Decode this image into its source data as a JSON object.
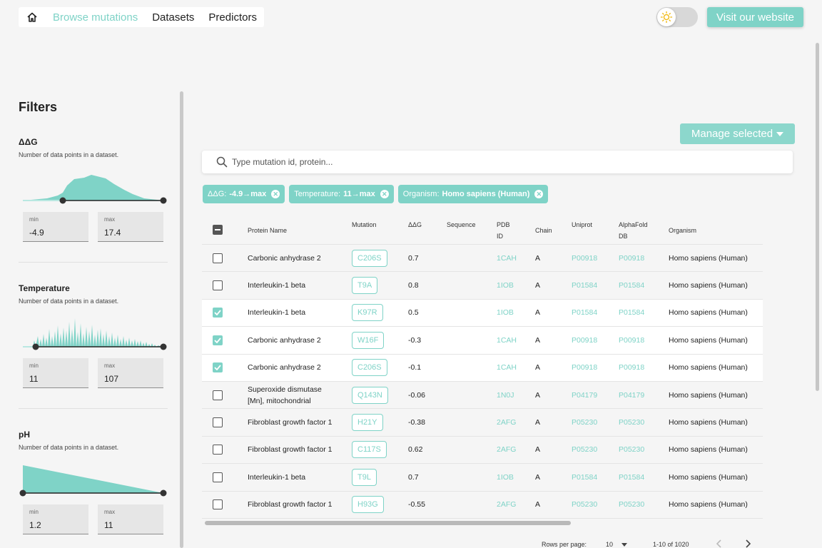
{
  "nav": {
    "items": [
      {
        "label": "Browse mutations",
        "active": true
      },
      {
        "label": "Datasets",
        "active": false
      },
      {
        "label": "Predictors",
        "active": false
      }
    ],
    "visit_label": "Visit our website"
  },
  "colors": {
    "accent": "#7fd3c7"
  },
  "icons": {
    "home": "home-icon",
    "theme": "sun-icon",
    "search": "search-icon"
  },
  "filters": {
    "title": "Filters",
    "items": [
      {
        "name": "ΔΔG",
        "description": "Number of data points in a dataset.",
        "min_label": "min",
        "max_label": "max",
        "min": "-4.9",
        "max": "17.4"
      },
      {
        "name": "Temperature",
        "description": "Number of data points in a dataset.",
        "min_label": "min",
        "max_label": "max",
        "min": "11",
        "max": "107"
      },
      {
        "name": "pH",
        "description": "Number of data points in a dataset.",
        "min_label": "min",
        "max_label": "max",
        "min": "1.2",
        "max": "11"
      }
    ]
  },
  "manage": {
    "label": "Manage selected"
  },
  "search": {
    "placeholder": "Type mutation id, protein..."
  },
  "chips": [
    {
      "label": "ΔΔG:",
      "value": "-4.9→max"
    },
    {
      "label": "Temperature:",
      "value": "11→max"
    },
    {
      "label": "Organism:",
      "value": "Homo sapiens (Human)"
    }
  ],
  "table": {
    "headers": {
      "protein": "Protein Name",
      "mutation": "Mutation",
      "ddg": "ΔΔG",
      "sequence": "Sequence",
      "pdb1": "PDB",
      "pdb2": "ID",
      "chain": "Chain",
      "uniprot": "Uniprot",
      "af1": "AlphaFold",
      "af2": "DB",
      "organism": "Organism"
    },
    "rows": [
      {
        "checked": false,
        "protein": "Carbonic anhydrase 2",
        "mutation": "C206S",
        "ddg": "0.7",
        "pdb": "1CAH",
        "chain": "A",
        "uniprot": "P00918",
        "alphafold": "P00918",
        "organism": "Homo sapiens (Human)"
      },
      {
        "checked": false,
        "protein": "Interleukin-1 beta",
        "mutation": "T9A",
        "ddg": "0.8",
        "pdb": "1IOB",
        "chain": "A",
        "uniprot": "P01584",
        "alphafold": "P01584",
        "organism": "Homo sapiens (Human)"
      },
      {
        "checked": true,
        "protein": "Interleukin-1 beta",
        "mutation": "K97R",
        "ddg": "0.5",
        "pdb": "1IOB",
        "chain": "A",
        "uniprot": "P01584",
        "alphafold": "P01584",
        "organism": "Homo sapiens (Human)"
      },
      {
        "checked": true,
        "protein": "Carbonic anhydrase 2",
        "mutation": "W16F",
        "ddg": "-0.3",
        "pdb": "1CAH",
        "chain": "A",
        "uniprot": "P00918",
        "alphafold": "P00918",
        "organism": "Homo sapiens (Human)"
      },
      {
        "checked": true,
        "protein": "Carbonic anhydrase 2",
        "mutation": "C206S",
        "ddg": "-0.1",
        "pdb": "1CAH",
        "chain": "A",
        "uniprot": "P00918",
        "alphafold": "P00918",
        "organism": "Homo sapiens (Human)"
      },
      {
        "checked": false,
        "protein": "Superoxide dismutase [Mn], mitochondrial",
        "mutation": "Q143N",
        "ddg": "-0.06",
        "pdb": "1N0J",
        "chain": "A",
        "uniprot": "P04179",
        "alphafold": "P04179",
        "organism": "Homo sapiens (Human)"
      },
      {
        "checked": false,
        "protein": "Fibroblast growth factor 1",
        "mutation": "H21Y",
        "ddg": "-0.38",
        "pdb": "2AFG",
        "chain": "A",
        "uniprot": "P05230",
        "alphafold": "P05230",
        "organism": "Homo sapiens (Human)"
      },
      {
        "checked": false,
        "protein": "Fibroblast growth factor 1",
        "mutation": "C117S",
        "ddg": "0.62",
        "pdb": "2AFG",
        "chain": "A",
        "uniprot": "P05230",
        "alphafold": "P05230",
        "organism": "Homo sapiens (Human)"
      },
      {
        "checked": false,
        "protein": "Interleukin-1 beta",
        "mutation": "T9L",
        "ddg": "0.7",
        "pdb": "1IOB",
        "chain": "A",
        "uniprot": "P01584",
        "alphafold": "P01584",
        "organism": "Homo sapiens (Human)"
      },
      {
        "checked": false,
        "protein": "Fibroblast growth factor 1",
        "mutation": "H93G",
        "ddg": "-0.55",
        "pdb": "2AFG",
        "chain": "A",
        "uniprot": "P05230",
        "alphafold": "P05230",
        "organism": "Homo sapiens (Human)"
      }
    ]
  },
  "pagination": {
    "rows_label": "Rows per page:",
    "rows_value": "10",
    "range": "1-10 of 1020"
  }
}
